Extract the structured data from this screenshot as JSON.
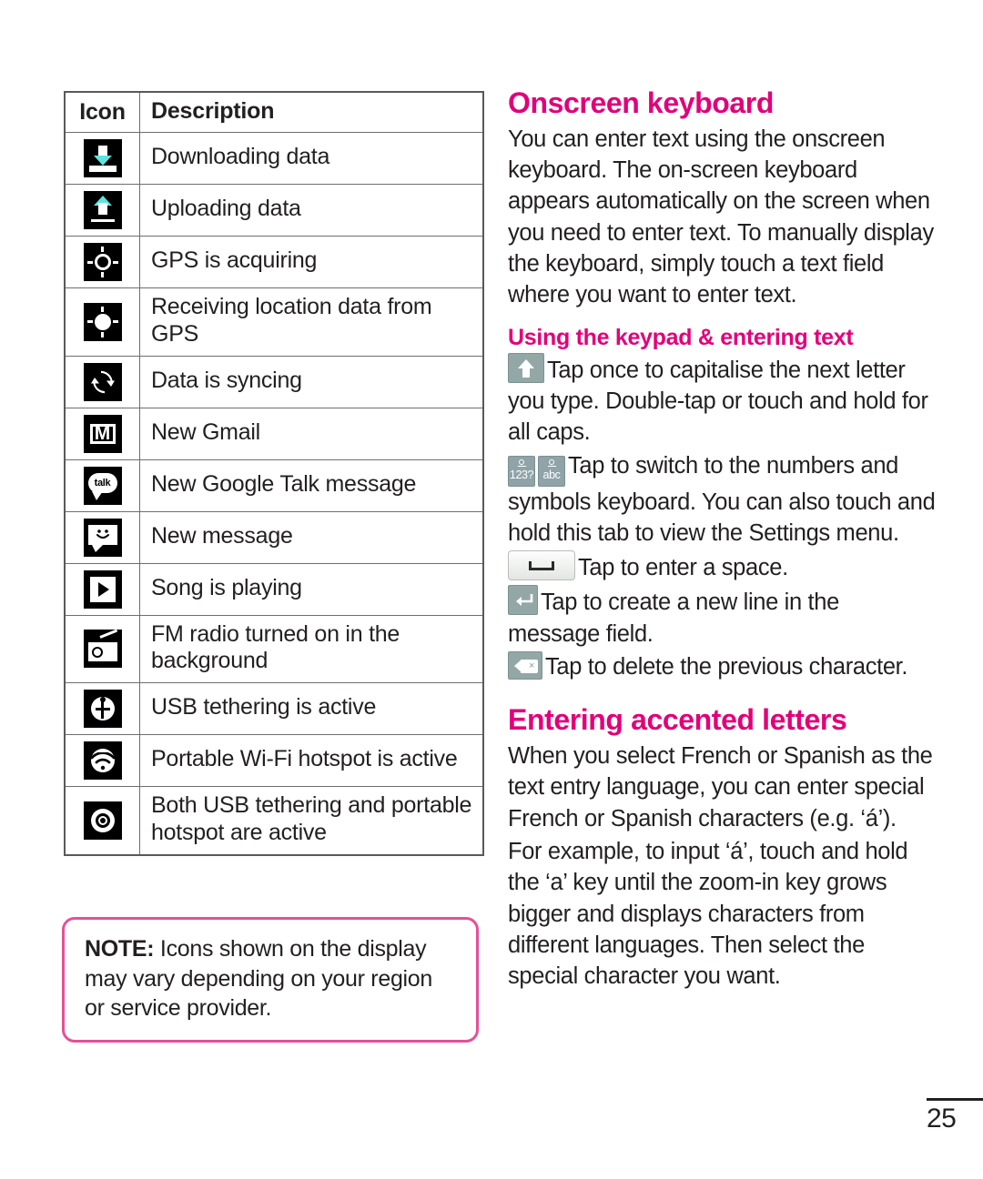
{
  "page": {
    "number": "25",
    "accent_pink": "#e2007a",
    "note_border_pink": "#e5509a",
    "arrow_cyan": "#5fe3dd"
  },
  "icon_table": {
    "headers": [
      "Icon",
      "Description"
    ],
    "rows": [
      {
        "icon": "download-arrow-icon",
        "description": "Downloading data"
      },
      {
        "icon": "upload-arrow-icon",
        "description": "Uploading data"
      },
      {
        "icon": "gps-acquiring-icon",
        "description": "GPS is acquiring"
      },
      {
        "icon": "gps-receiving-icon",
        "description": "Receiving location data from GPS"
      },
      {
        "icon": "sync-icon",
        "description": "Data is syncing"
      },
      {
        "icon": "gmail-icon",
        "description": "New Gmail"
      },
      {
        "icon": "google-talk-icon",
        "description": "New Google Talk message"
      },
      {
        "icon": "new-message-icon",
        "description": "New message"
      },
      {
        "icon": "play-icon",
        "description": "Song is playing"
      },
      {
        "icon": "fm-radio-icon",
        "description": "FM radio turned on in the background"
      },
      {
        "icon": "usb-tethering-icon",
        "description": "USB tethering is active"
      },
      {
        "icon": "wifi-hotspot-icon",
        "description": "Portable Wi-Fi hotspot is active"
      },
      {
        "icon": "tethering-and-hotspot-icon",
        "description": "Both USB tethering and portable hotspot are active"
      }
    ]
  },
  "note": {
    "label": "NOTE:",
    "text": " Icons shown on the display may vary depending on your region or service provider."
  },
  "onscreen_keyboard": {
    "heading": "Onscreen keyboard",
    "intro": "You can enter text using the onscreen keyboard. The on-screen keyboard appears automatically on the screen when you need to enter text. To manually display the keyboard, simply touch a text field where you want to enter text.",
    "subheading": "Using the keypad & entering text",
    "items": [
      {
        "key": "shift-key",
        "text": "Tap once to capitalise the next letter you type. Double-tap or touch and hold for all caps."
      },
      {
        "key": "mode-switch-keys",
        "key_labels": [
          "123?",
          "abc"
        ],
        "text": "Tap to switch to the numbers and symbols keyboard. You can also touch and hold this tab to view the Settings menu."
      },
      {
        "key": "space-key",
        "text": "Tap to enter a space."
      },
      {
        "key": "enter-key",
        "text": "Tap to create a new line in the message field."
      },
      {
        "key": "delete-key",
        "text": "Tap to delete the previous character."
      }
    ]
  },
  "accented_letters": {
    "heading": "Entering accented letters",
    "paragraphs": [
      "When you select French or Spanish as the text entry language, you can enter special French or Spanish characters (e.g. ‘á’).",
      "For example, to input ‘á’, touch and hold the ‘a’ key until the zoom-in key grows bigger and displays characters from different languages. Then select the special character you want."
    ]
  },
  "glyph_text": {
    "gmail_letter": "M",
    "talk_label": "talk",
    "sms_face": "◡",
    "delete_x": "×"
  }
}
